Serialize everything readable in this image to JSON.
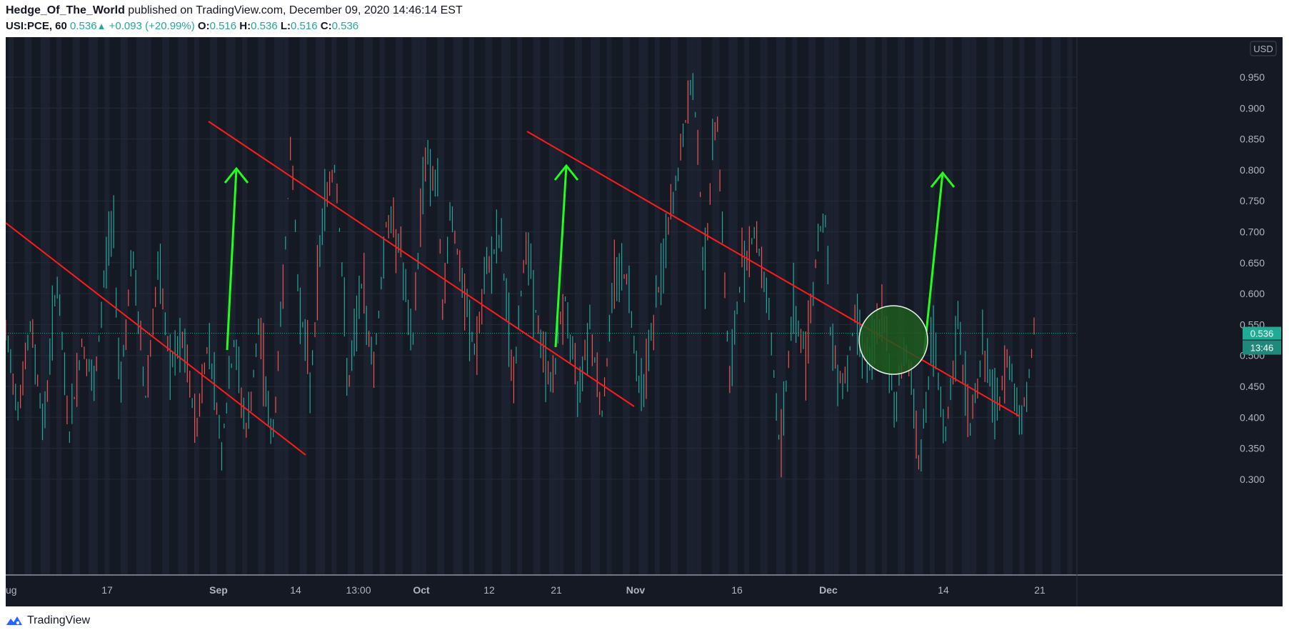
{
  "header": {
    "author": "Hedge_Of_The_World",
    "published": "published on TradingView.com, December 09, 2020 14:46:14 EST",
    "symbol": "USI:PCE, 60",
    "last": "0.536",
    "change": "+0.093 (+20.99%)",
    "o_label": "O:",
    "o_val": "0.516",
    "h_label": "H:",
    "h_val": "0.536",
    "l_label": "L:",
    "l_val": "0.516",
    "c_label": "C:",
    "c_val": "0.536"
  },
  "footer": {
    "brand": "TradingView"
  },
  "chart_data": {
    "type": "candlestick",
    "currency": "USD",
    "ylim": [
      0.27,
      0.99
    ],
    "y_ticks": [
      "0.950",
      "0.900",
      "0.850",
      "0.800",
      "0.750",
      "0.700",
      "0.650",
      "0.600",
      "0.550",
      "0.500",
      "0.450",
      "0.400",
      "0.350",
      "0.300"
    ],
    "x_ticks": [
      "ug",
      "17",
      "Sep",
      "14",
      "13:00",
      "Oct",
      "12",
      "21",
      "Nov",
      "16",
      "Dec",
      "14",
      "21"
    ],
    "x_tick_bold": [
      "Sep",
      "Oct",
      "Nov",
      "Dec"
    ],
    "last_price_label": "0.536",
    "countdown_label": "13:46",
    "series": [
      {
        "name": "USI:PCE",
        "approx_path": [
          [
            0,
            0.53
          ],
          [
            0.01,
            0.42
          ],
          [
            0.02,
            0.55
          ],
          [
            0.03,
            0.38
          ],
          [
            0.04,
            0.63
          ],
          [
            0.05,
            0.37
          ],
          [
            0.06,
            0.52
          ],
          [
            0.07,
            0.44
          ],
          [
            0.08,
            0.68
          ],
          [
            0.085,
            0.71
          ],
          [
            0.09,
            0.45
          ],
          [
            0.1,
            0.66
          ],
          [
            0.11,
            0.43
          ],
          [
            0.12,
            0.64
          ],
          [
            0.13,
            0.48
          ],
          [
            0.14,
            0.52
          ],
          [
            0.15,
            0.38
          ],
          [
            0.16,
            0.53
          ],
          [
            0.17,
            0.35
          ],
          [
            0.18,
            0.52
          ],
          [
            0.19,
            0.37
          ],
          [
            0.2,
            0.55
          ],
          [
            0.21,
            0.35
          ],
          [
            0.215,
            0.5
          ],
          [
            0.22,
            0.68
          ],
          [
            0.225,
            0.84
          ],
          [
            0.23,
            0.62
          ],
          [
            0.24,
            0.45
          ],
          [
            0.25,
            0.74
          ],
          [
            0.26,
            0.81
          ],
          [
            0.27,
            0.44
          ],
          [
            0.28,
            0.62
          ],
          [
            0.29,
            0.48
          ],
          [
            0.3,
            0.72
          ],
          [
            0.31,
            0.69
          ],
          [
            0.32,
            0.5
          ],
          [
            0.33,
            0.83
          ],
          [
            0.34,
            0.77
          ],
          [
            0.345,
            0.55
          ],
          [
            0.35,
            0.75
          ],
          [
            0.36,
            0.6
          ],
          [
            0.37,
            0.5
          ],
          [
            0.38,
            0.65
          ],
          [
            0.39,
            0.69
          ],
          [
            0.4,
            0.45
          ],
          [
            0.41,
            0.7
          ],
          [
            0.42,
            0.53
          ],
          [
            0.43,
            0.45
          ],
          [
            0.44,
            0.6
          ],
          [
            0.45,
            0.44
          ],
          [
            0.46,
            0.56
          ],
          [
            0.47,
            0.4
          ],
          [
            0.48,
            0.65
          ],
          [
            0.49,
            0.62
          ],
          [
            0.5,
            0.44
          ],
          [
            0.51,
            0.55
          ],
          [
            0.52,
            0.68
          ],
          [
            0.53,
            0.8
          ],
          [
            0.54,
            0.94
          ],
          [
            0.545,
            0.86
          ],
          [
            0.55,
            0.62
          ],
          [
            0.56,
            0.91
          ],
          [
            0.57,
            0.45
          ],
          [
            0.58,
            0.65
          ],
          [
            0.59,
            0.7
          ],
          [
            0.6,
            0.6
          ],
          [
            0.61,
            0.34
          ],
          [
            0.62,
            0.58
          ],
          [
            0.63,
            0.5
          ],
          [
            0.64,
            0.69
          ],
          [
            0.645,
            0.74
          ],
          [
            0.65,
            0.52
          ],
          [
            0.66,
            0.45
          ],
          [
            0.67,
            0.57
          ],
          [
            0.68,
            0.48
          ],
          [
            0.69,
            0.57
          ],
          [
            0.7,
            0.42
          ],
          [
            0.71,
            0.52
          ],
          [
            0.72,
            0.32
          ],
          [
            0.73,
            0.53
          ],
          [
            0.74,
            0.36
          ],
          [
            0.75,
            0.55
          ],
          [
            0.76,
            0.38
          ],
          [
            0.77,
            0.52
          ],
          [
            0.78,
            0.4
          ],
          [
            0.79,
            0.5
          ],
          [
            0.8,
            0.39
          ],
          [
            0.805,
            0.46
          ],
          [
            0.81,
            0.536
          ]
        ]
      }
    ],
    "annotations": {
      "red_trendlines": 3,
      "green_arrows": 3,
      "highlight_circle": "green"
    }
  },
  "colors": {
    "background": "#151924",
    "grid": "#242a37",
    "up": "#26a69a",
    "down": "#ef5350",
    "trendline": "#ff1c1c",
    "arrow": "#22ff1a",
    "circle_fill": "#1f5a1f",
    "axis_text": "#b2b5be",
    "price_label_bg": "#22ab94"
  }
}
